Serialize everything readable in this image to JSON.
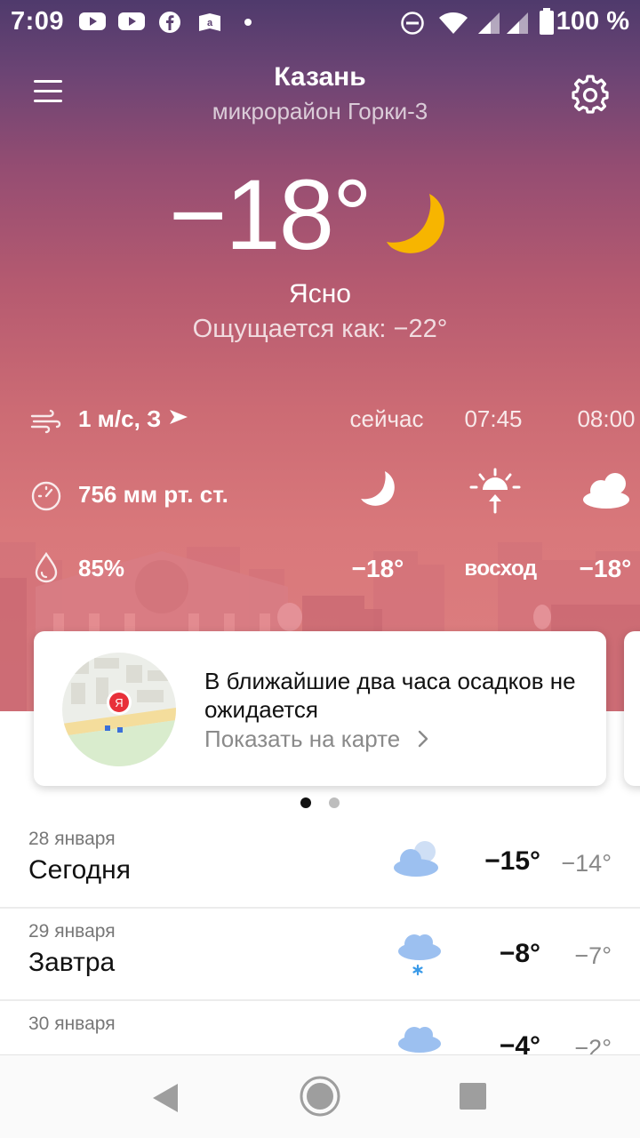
{
  "status_bar": {
    "time": "7:09",
    "battery": "100 %",
    "notification_icons": [
      "youtube-icon",
      "youtube-icon",
      "facebook-icon",
      "amazon-kindle-icon",
      "dot-icon"
    ],
    "system_icons": [
      "do-not-disturb-icon",
      "wifi-icon",
      "signal-icon",
      "signal-icon",
      "battery-icon"
    ]
  },
  "header": {
    "city": "Казань",
    "district": "микрорайон Горки-3"
  },
  "current": {
    "temperature": "−18°",
    "condition": "Ясно",
    "feels_like": "Ощущается как: −22°",
    "icon": "moon-icon"
  },
  "stats": {
    "wind": "1 м/с, З",
    "pressure": "756 мм рт. ст.",
    "humidity": "85%"
  },
  "hourly": [
    {
      "time": "сейчас",
      "value": "−18°",
      "icon": "moon-icon"
    },
    {
      "time": "07:45",
      "value": "восход",
      "icon": "sunrise-icon"
    },
    {
      "time": "08:00",
      "value": "−18°",
      "icon": "cloudy-icon"
    }
  ],
  "nowcast_card": {
    "message": "В ближайшие два часа осадков не ожидается",
    "link": "Показать на карте",
    "map_pin_label": "Я"
  },
  "pager": {
    "pages": 2,
    "active": 1
  },
  "forecast": [
    {
      "date": "28 января",
      "day": "Сегодня",
      "max": "−15°",
      "min": "−14°",
      "icon": "cloudy-icon"
    },
    {
      "date": "29 января",
      "day": "Завтра",
      "max": "−8°",
      "min": "−7°",
      "icon": "snow-cloud-icon"
    },
    {
      "date": "30 января",
      "day": "",
      "max": "−4°",
      "min": "−2°",
      "icon": "cloud-icon"
    }
  ],
  "colors": {
    "accent_moon": "#f7b500",
    "map_pin": "#e8303a",
    "cloud_blue": "#9cc0f0"
  }
}
